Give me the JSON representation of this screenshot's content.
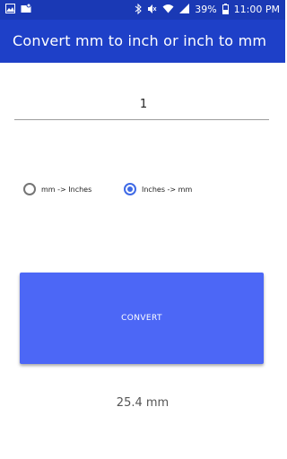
{
  "status_bar": {
    "battery": "39%",
    "time": "11:00 PM",
    "icons": [
      "image-icon",
      "mail-icon",
      "bluetooth-icon",
      "mute-icon",
      "wifi-icon",
      "signal-icon",
      "battery-icon"
    ]
  },
  "app_bar": {
    "title": "Convert mm to inch or inch to mm"
  },
  "input": {
    "value": "1"
  },
  "radios": {
    "mm_to_inches": {
      "label": "mm -> Inches",
      "checked": false
    },
    "inches_to_mm": {
      "label": "Inches -> mm",
      "checked": true
    }
  },
  "button": {
    "label": "CONVERT"
  },
  "result": {
    "text": "25.4  mm"
  },
  "colors": {
    "status_bar": "#1a39b5",
    "app_bar": "#1e40c8",
    "accent": "#3f6ae6",
    "button": "#4c67f6"
  }
}
